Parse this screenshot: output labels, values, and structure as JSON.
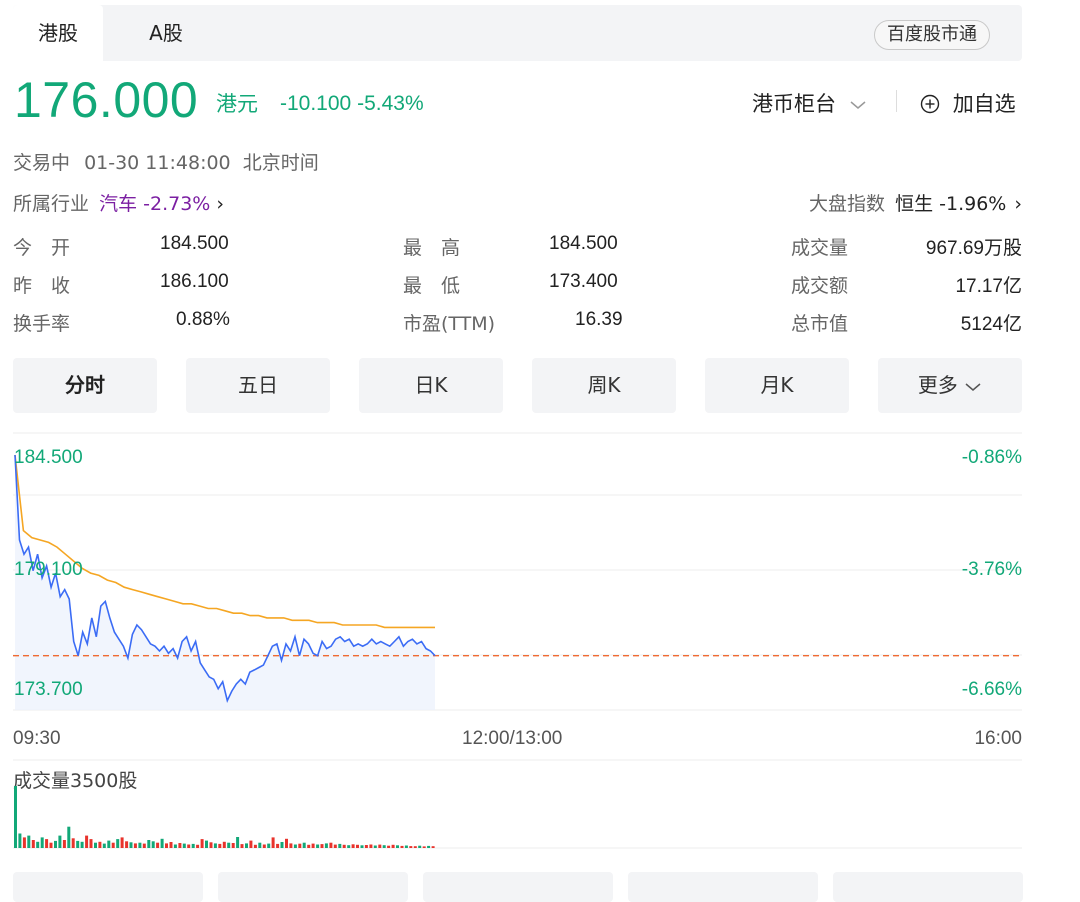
{
  "tabs": [
    {
      "label": "港股",
      "active": true
    },
    {
      "label": "A股",
      "active": false
    }
  ],
  "brand_pill": "百度股市通",
  "quote": {
    "price": "176.000",
    "currency": "港元",
    "change": "-10.100",
    "change_pct": "-5.43%",
    "counter_label": "港币柜台",
    "add_watchlist": "加自选",
    "status": "交易中",
    "datetime": "01-30 11:48:00",
    "timezone": "北京时间",
    "industry_label": "所属行业",
    "industry_name": "汽车",
    "industry_change": "-2.73%",
    "index_label": "大盘指数",
    "index_name": "恒生",
    "index_change": "-1.96%"
  },
  "stats": {
    "open_label": "今　开",
    "open": "184.500",
    "prev_close_label": "昨　收",
    "prev_close": "186.100",
    "turnover_rate_label": "换手率",
    "turnover_rate": "0.88%",
    "high_label": "最　高",
    "high": "184.500",
    "low_label": "最　低",
    "low": "173.400",
    "pe_label": "市盈(TTM)",
    "pe": "16.39",
    "volume_label": "成交量",
    "volume": "967.69万股",
    "amount_label": "成交额",
    "amount": "17.17亿",
    "market_cap_label": "总市值",
    "market_cap": "5124亿"
  },
  "period_tabs": [
    "分时",
    "五日",
    "日K",
    "周K",
    "月K",
    "更多"
  ],
  "chart": {
    "y_left": [
      "184.500",
      "179.100",
      "173.700"
    ],
    "y_right": [
      "-0.86%",
      "-3.76%",
      "-6.66%"
    ],
    "times": [
      "09:30",
      "12:00/13:00",
      "16:00"
    ],
    "volume_label": "成交量3500股",
    "colors": {
      "price_line": "#3b6cf5",
      "avg_line": "#f5a623",
      "ref_line": "#f06a32",
      "up": "#e8332c",
      "down": "#12a878"
    }
  },
  "chart_data": {
    "type": "line",
    "title": "",
    "x_range": [
      "09:30",
      "16:00"
    ],
    "ylim": [
      173.7,
      184.5
    ],
    "reference_price": 176.0,
    "series": [
      {
        "values": [
          184.5,
          180.9,
          180.3,
          180.6,
          179.6,
          180.3,
          179.3,
          179.8,
          178.9,
          179.5,
          178.5,
          178.8,
          178.4,
          176.6,
          176.0,
          177.0,
          176.5,
          177.6,
          176.8,
          178.1,
          178.3,
          177.6,
          177.0,
          176.7,
          176.4,
          175.9,
          176.9,
          177.3,
          177.1,
          176.8,
          176.5,
          176.4,
          176.2,
          176.4,
          176.1,
          176.3,
          175.9,
          176.6,
          176.8,
          176.2,
          176.6,
          175.7,
          175.4,
          175.1,
          175.0,
          174.6,
          174.9,
          174.1,
          174.5,
          174.8,
          175.0,
          174.8,
          175.3,
          175.4,
          175.5,
          175.6,
          176.0,
          176.4,
          176.5,
          175.8,
          176.5,
          176.2,
          176.8,
          176.0,
          176.7,
          176.5,
          176.1,
          176.0,
          176.6,
          176.3,
          176.4,
          176.7,
          176.8,
          176.6,
          176.7,
          176.4,
          176.5,
          176.4,
          176.5,
          176.7,
          176.5,
          176.6,
          176.5,
          176.4,
          176.6,
          176.8,
          176.4,
          176.6,
          176.7,
          176.5,
          176.6,
          176.3,
          176.2,
          176.0
        ]
      },
      {
        "values": [
          184.5,
          181.3,
          181.0,
          180.9,
          180.8,
          180.6,
          180.3,
          180.0,
          179.7,
          179.5,
          179.4,
          179.2,
          179.1,
          178.9,
          178.8,
          178.7,
          178.6,
          178.5,
          178.4,
          178.3,
          178.2,
          178.2,
          178.1,
          178.0,
          178.0,
          177.9,
          177.8,
          177.8,
          177.7,
          177.7,
          177.6,
          177.6,
          177.6,
          177.5,
          177.5,
          177.5,
          177.4,
          177.4,
          177.4,
          177.3,
          177.3,
          177.3,
          177.3,
          177.3,
          177.2,
          177.2,
          177.2,
          177.2,
          177.2,
          177.2,
          177.2
        ]
      }
    ],
    "volume": {
      "ylim_label": "成交量3500股",
      "bars": [
        3500,
        820,
        600,
        700,
        450,
        350,
        600,
        500,
        300,
        400,
        700,
        450,
        1200,
        550,
        400,
        350,
        700,
        500,
        300,
        350,
        250,
        420,
        300,
        500,
        600,
        380,
        320,
        260,
        300,
        250,
        450,
        380,
        300,
        520,
        260,
        340,
        200,
        280,
        250,
        200,
        230,
        180,
        500,
        420,
        320,
        260,
        230,
        350,
        300,
        280,
        620,
        220,
        260,
        420,
        180,
        300,
        200,
        250,
        600,
        230,
        340,
        520,
        260,
        200,
        240,
        300,
        180,
        250,
        200,
        220,
        260,
        300,
        190,
        230,
        180,
        160,
        210,
        180,
        150,
        170,
        200,
        140,
        190,
        160,
        130,
        180,
        150,
        120,
        140,
        110,
        100,
        130,
        90,
        120,
        100
      ],
      "bar_up": [
        false,
        false,
        true,
        false,
        true,
        false,
        false,
        true,
        true,
        false,
        false,
        true,
        false,
        true,
        false,
        false,
        true,
        true,
        false,
        true,
        false,
        false,
        true,
        false,
        true,
        true,
        false,
        true,
        false,
        true,
        false,
        false,
        true,
        false,
        true,
        true,
        false,
        true,
        false,
        true,
        false,
        true,
        true,
        false,
        true,
        false,
        true,
        true,
        false,
        true,
        false,
        true,
        false,
        true,
        true,
        false,
        true,
        false,
        true,
        true,
        false,
        true,
        true,
        false,
        true,
        false,
        true,
        true,
        false,
        true,
        false,
        true,
        true,
        false,
        true,
        false,
        true,
        true,
        false,
        true,
        true,
        false,
        true,
        false,
        true,
        true,
        false,
        true,
        false,
        true,
        true,
        false,
        true,
        false,
        true
      ]
    }
  }
}
